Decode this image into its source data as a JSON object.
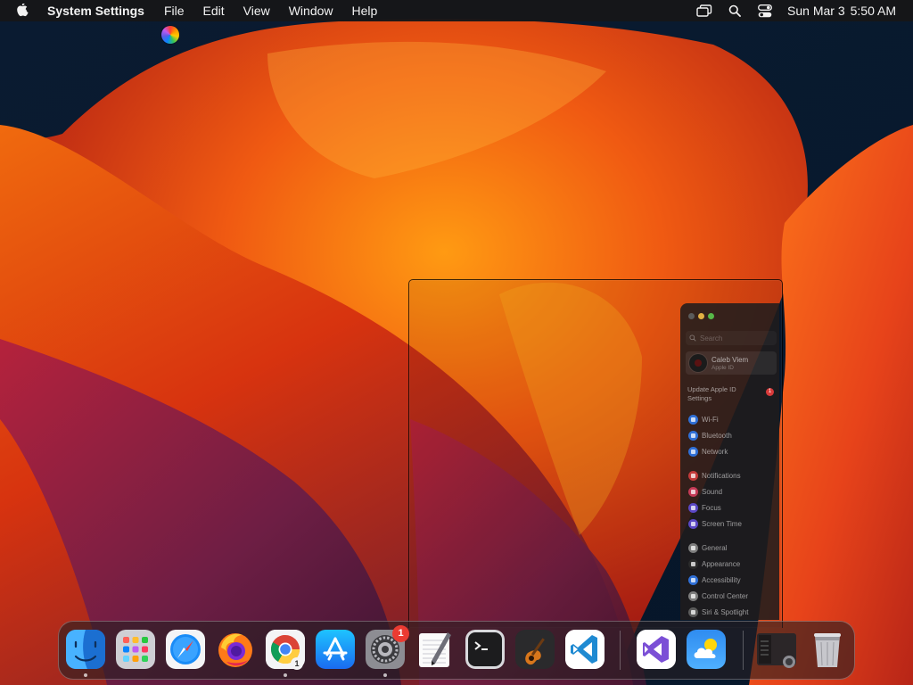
{
  "menubar": {
    "apple_icon": "apple-logo-icon",
    "app_name": "System Settings",
    "menus": [
      "File",
      "Edit",
      "View",
      "Window",
      "Help"
    ],
    "status_icons": [
      "screen-mirroring-icon",
      "spotlight-search-icon",
      "control-center-icon"
    ],
    "date": "Sun Mar 3",
    "time": "5:50 AM"
  },
  "cursor": {
    "icon": "busy-color-wheel-icon"
  },
  "settings": {
    "traffic_lights": {
      "close": "#5b5b5b",
      "minimize": "#e3b143",
      "maximize": "#57b848"
    },
    "search_placeholder": "Search",
    "account": {
      "name": "Caleb Viem",
      "subtitle": "Apple ID"
    },
    "update_text": "Update Apple ID Settings",
    "update_count": "1",
    "groups": [
      [
        {
          "label": "Wi-Fi",
          "color": "#2f6fd6"
        },
        {
          "label": "Bluetooth",
          "color": "#2f6fd6"
        },
        {
          "label": "Network",
          "color": "#2f6fd6"
        }
      ],
      [
        {
          "label": "Notifications",
          "color": "#c43a3a"
        },
        {
          "label": "Sound",
          "color": "#c43a56"
        },
        {
          "label": "Focus",
          "color": "#5a47c4"
        },
        {
          "label": "Screen Time",
          "color": "#5a47c4"
        }
      ],
      [
        {
          "label": "General",
          "color": "#7d7d7d"
        },
        {
          "label": "Appearance",
          "color": "#2b2b2b"
        },
        {
          "label": "Accessibility",
          "color": "#2f6fd6"
        },
        {
          "label": "Control Center",
          "color": "#7d7d7d"
        },
        {
          "label": "Siri & Spotlight",
          "color": "#5b5b5b"
        }
      ]
    ]
  },
  "dock": {
    "apps": [
      {
        "name": "Finder",
        "icon": "finder-icon",
        "running": true
      },
      {
        "name": "Launchpad",
        "icon": "launchpad-icon",
        "running": false
      },
      {
        "name": "Safari",
        "icon": "safari-icon",
        "running": false
      },
      {
        "name": "Firefox",
        "icon": "firefox-icon",
        "running": false
      },
      {
        "name": "Google Chrome",
        "icon": "chrome-icon",
        "running": true,
        "badge": "1"
      },
      {
        "name": "App Store",
        "icon": "app-store-icon",
        "running": false
      },
      {
        "name": "System Settings",
        "icon": "system-settings-icon",
        "running": true,
        "badge": "1"
      },
      {
        "name": "TextEdit",
        "icon": "textedit-icon",
        "running": false
      },
      {
        "name": "Terminal",
        "icon": "terminal-icon",
        "running": false
      },
      {
        "name": "GarageBand",
        "icon": "garageband-icon",
        "running": false
      },
      {
        "name": "Visual Studio Code",
        "icon": "vscode-icon",
        "running": false
      },
      {
        "name": "Visual Studio",
        "icon": "visual-studio-icon",
        "running": false
      },
      {
        "name": "Weather",
        "icon": "weather-icon",
        "running": false
      },
      {
        "name": "Minimized System Settings",
        "icon": "minimized-window-icon",
        "running": false
      },
      {
        "name": "Trash",
        "icon": "trash-icon",
        "running": false
      }
    ]
  }
}
